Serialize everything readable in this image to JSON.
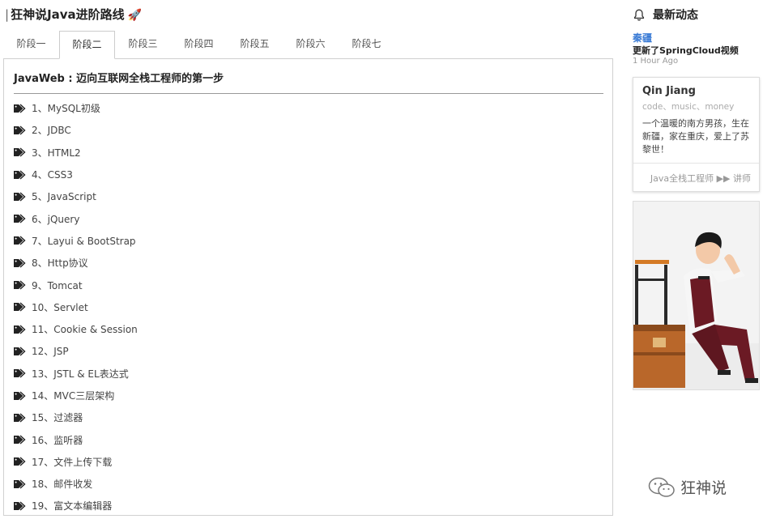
{
  "page": {
    "title_bar": "|",
    "title": "狂神说Java进阶路线",
    "title_emoji": "🚀"
  },
  "tabs": [
    {
      "label": "阶段一",
      "active": false
    },
    {
      "label": "阶段二",
      "active": true
    },
    {
      "label": "阶段三",
      "active": false
    },
    {
      "label": "阶段四",
      "active": false
    },
    {
      "label": "阶段五",
      "active": false
    },
    {
      "label": "阶段六",
      "active": false
    },
    {
      "label": "阶段七",
      "active": false
    }
  ],
  "panel": {
    "title": "JavaWeb : 迈向互联网全栈工程师的第一步",
    "items": [
      "1、MySQL初级",
      "2、JDBC",
      "3、HTML2",
      "4、CSS3",
      "5、JavaScript",
      "6、jQuery",
      "7、Layui & BootStrap",
      "8、Http协议",
      "9、Tomcat",
      "10、Servlet",
      "11、Cookie & Session",
      "12、JSP",
      "13、JSTL & EL表达式",
      "14、MVC三层架构",
      "15、过滤器",
      "16、监听器",
      "17、文件上传下载",
      "18、邮件收发",
      "19、富文本编辑器"
    ]
  },
  "sidebar": {
    "heading": "最新动态",
    "activity": {
      "user": "秦疆",
      "text": "更新了SpringCloud视频",
      "time": "1 Hour Ago"
    },
    "profile": {
      "name": "Qin Jiang",
      "tags": "code、music、money",
      "bio": "一个温暖的南方男孩，生在新疆，家在重庆，爱上了苏黎世！",
      "footer": "Java全栈工程师 ▶▶ 讲师"
    }
  },
  "watermark": {
    "text": "狂神说"
  },
  "colors": {
    "link": "#3a7bd5",
    "border": "#d0d0d0",
    "text": "#333333"
  }
}
